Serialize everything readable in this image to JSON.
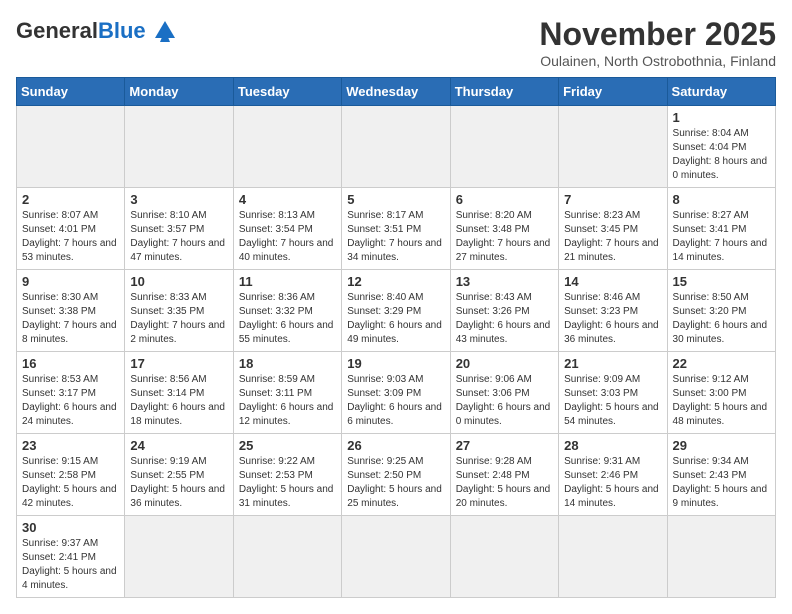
{
  "header": {
    "logo_general": "General",
    "logo_blue": "Blue",
    "month_title": "November 2025",
    "subtitle": "Oulainen, North Ostrobothnia, Finland"
  },
  "columns": [
    "Sunday",
    "Monday",
    "Tuesday",
    "Wednesday",
    "Thursday",
    "Friday",
    "Saturday"
  ],
  "weeks": [
    [
      {
        "day": "",
        "info": "",
        "empty": true
      },
      {
        "day": "",
        "info": "",
        "empty": true
      },
      {
        "day": "",
        "info": "",
        "empty": true
      },
      {
        "day": "",
        "info": "",
        "empty": true
      },
      {
        "day": "",
        "info": "",
        "empty": true
      },
      {
        "day": "",
        "info": "",
        "empty": true
      },
      {
        "day": "1",
        "info": "Sunrise: 8:04 AM\nSunset: 4:04 PM\nDaylight: 8 hours\nand 0 minutes.",
        "empty": false
      }
    ],
    [
      {
        "day": "2",
        "info": "Sunrise: 8:07 AM\nSunset: 4:01 PM\nDaylight: 7 hours\nand 53 minutes.",
        "empty": false
      },
      {
        "day": "3",
        "info": "Sunrise: 8:10 AM\nSunset: 3:57 PM\nDaylight: 7 hours\nand 47 minutes.",
        "empty": false
      },
      {
        "day": "4",
        "info": "Sunrise: 8:13 AM\nSunset: 3:54 PM\nDaylight: 7 hours\nand 40 minutes.",
        "empty": false
      },
      {
        "day": "5",
        "info": "Sunrise: 8:17 AM\nSunset: 3:51 PM\nDaylight: 7 hours\nand 34 minutes.",
        "empty": false
      },
      {
        "day": "6",
        "info": "Sunrise: 8:20 AM\nSunset: 3:48 PM\nDaylight: 7 hours\nand 27 minutes.",
        "empty": false
      },
      {
        "day": "7",
        "info": "Sunrise: 8:23 AM\nSunset: 3:45 PM\nDaylight: 7 hours\nand 21 minutes.",
        "empty": false
      },
      {
        "day": "8",
        "info": "Sunrise: 8:27 AM\nSunset: 3:41 PM\nDaylight: 7 hours\nand 14 minutes.",
        "empty": false
      }
    ],
    [
      {
        "day": "9",
        "info": "Sunrise: 8:30 AM\nSunset: 3:38 PM\nDaylight: 7 hours\nand 8 minutes.",
        "empty": false
      },
      {
        "day": "10",
        "info": "Sunrise: 8:33 AM\nSunset: 3:35 PM\nDaylight: 7 hours\nand 2 minutes.",
        "empty": false
      },
      {
        "day": "11",
        "info": "Sunrise: 8:36 AM\nSunset: 3:32 PM\nDaylight: 6 hours\nand 55 minutes.",
        "empty": false
      },
      {
        "day": "12",
        "info": "Sunrise: 8:40 AM\nSunset: 3:29 PM\nDaylight: 6 hours\nand 49 minutes.",
        "empty": false
      },
      {
        "day": "13",
        "info": "Sunrise: 8:43 AM\nSunset: 3:26 PM\nDaylight: 6 hours\nand 43 minutes.",
        "empty": false
      },
      {
        "day": "14",
        "info": "Sunrise: 8:46 AM\nSunset: 3:23 PM\nDaylight: 6 hours\nand 36 minutes.",
        "empty": false
      },
      {
        "day": "15",
        "info": "Sunrise: 8:50 AM\nSunset: 3:20 PM\nDaylight: 6 hours\nand 30 minutes.",
        "empty": false
      }
    ],
    [
      {
        "day": "16",
        "info": "Sunrise: 8:53 AM\nSunset: 3:17 PM\nDaylight: 6 hours\nand 24 minutes.",
        "empty": false
      },
      {
        "day": "17",
        "info": "Sunrise: 8:56 AM\nSunset: 3:14 PM\nDaylight: 6 hours\nand 18 minutes.",
        "empty": false
      },
      {
        "day": "18",
        "info": "Sunrise: 8:59 AM\nSunset: 3:11 PM\nDaylight: 6 hours\nand 12 minutes.",
        "empty": false
      },
      {
        "day": "19",
        "info": "Sunrise: 9:03 AM\nSunset: 3:09 PM\nDaylight: 6 hours\nand 6 minutes.",
        "empty": false
      },
      {
        "day": "20",
        "info": "Sunrise: 9:06 AM\nSunset: 3:06 PM\nDaylight: 6 hours\nand 0 minutes.",
        "empty": false
      },
      {
        "day": "21",
        "info": "Sunrise: 9:09 AM\nSunset: 3:03 PM\nDaylight: 5 hours\nand 54 minutes.",
        "empty": false
      },
      {
        "day": "22",
        "info": "Sunrise: 9:12 AM\nSunset: 3:00 PM\nDaylight: 5 hours\nand 48 minutes.",
        "empty": false
      }
    ],
    [
      {
        "day": "23",
        "info": "Sunrise: 9:15 AM\nSunset: 2:58 PM\nDaylight: 5 hours\nand 42 minutes.",
        "empty": false
      },
      {
        "day": "24",
        "info": "Sunrise: 9:19 AM\nSunset: 2:55 PM\nDaylight: 5 hours\nand 36 minutes.",
        "empty": false
      },
      {
        "day": "25",
        "info": "Sunrise: 9:22 AM\nSunset: 2:53 PM\nDaylight: 5 hours\nand 31 minutes.",
        "empty": false
      },
      {
        "day": "26",
        "info": "Sunrise: 9:25 AM\nSunset: 2:50 PM\nDaylight: 5 hours\nand 25 minutes.",
        "empty": false
      },
      {
        "day": "27",
        "info": "Sunrise: 9:28 AM\nSunset: 2:48 PM\nDaylight: 5 hours\nand 20 minutes.",
        "empty": false
      },
      {
        "day": "28",
        "info": "Sunrise: 9:31 AM\nSunset: 2:46 PM\nDaylight: 5 hours\nand 14 minutes.",
        "empty": false
      },
      {
        "day": "29",
        "info": "Sunrise: 9:34 AM\nSunset: 2:43 PM\nDaylight: 5 hours\nand 9 minutes.",
        "empty": false
      }
    ],
    [
      {
        "day": "30",
        "info": "Sunrise: 9:37 AM\nSunset: 2:41 PM\nDaylight: 5 hours\nand 4 minutes.",
        "empty": false
      },
      {
        "day": "",
        "info": "",
        "empty": true
      },
      {
        "day": "",
        "info": "",
        "empty": true
      },
      {
        "day": "",
        "info": "",
        "empty": true
      },
      {
        "day": "",
        "info": "",
        "empty": true
      },
      {
        "day": "",
        "info": "",
        "empty": true
      },
      {
        "day": "",
        "info": "",
        "empty": true
      }
    ]
  ]
}
